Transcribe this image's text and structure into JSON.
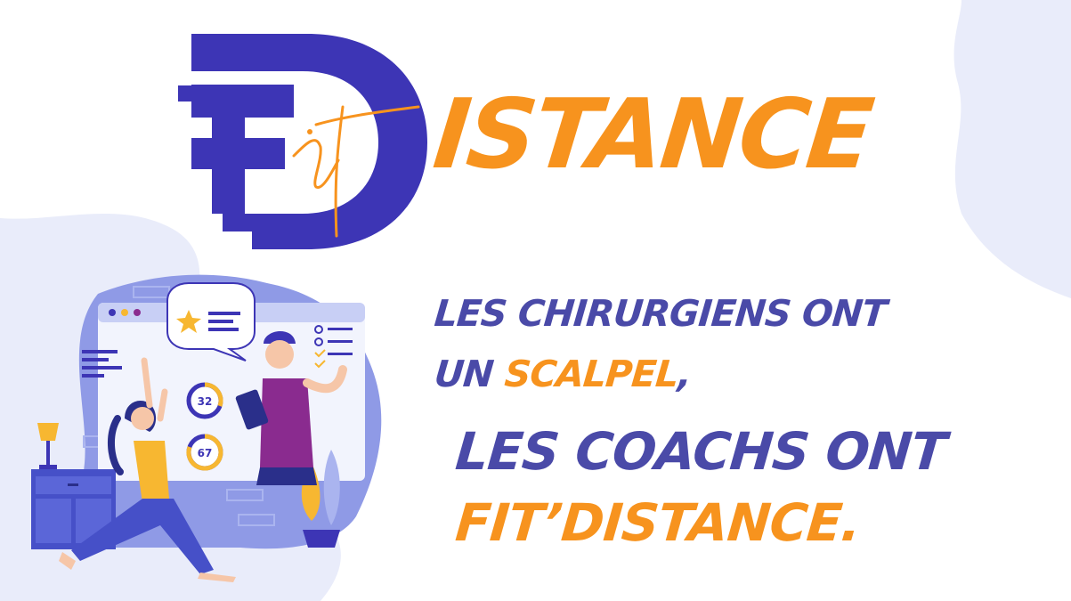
{
  "logo": {
    "letters_mark": "FD",
    "script_text": "it",
    "wordmark": "ISTANCE"
  },
  "slogan": {
    "line1": "LES CHIRURGIENS ONT",
    "line2_prefix": "UN ",
    "line2_accent": "SCALPEL",
    "line2_suffix": ",",
    "line3": "LES COACHS ONT",
    "line4": "FIT’DISTANCE."
  },
  "illustration": {
    "badge_1": "32",
    "badge_2": "67"
  },
  "colors": {
    "brand_blue": "#3d35b5",
    "slogan_blue": "#4a4aa8",
    "brand_orange": "#f7931e",
    "blob": "#e9ecfa"
  }
}
